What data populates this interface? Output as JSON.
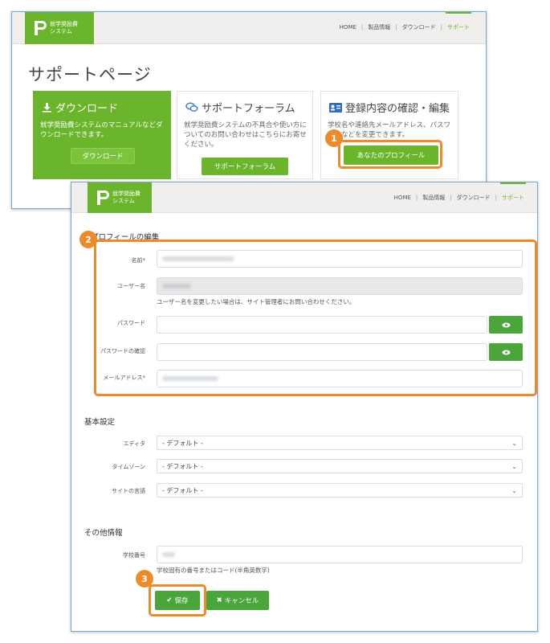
{
  "colors": {
    "brand": "#6ab52c",
    "callout": "#ec8a2c",
    "eye_button": "#4aa53a"
  },
  "logo": {
    "line1": "就学奨励費",
    "line2": "システム"
  },
  "nav": {
    "home": "HOME",
    "products": "製品情報",
    "download": "ダウンロード",
    "support": "サポート",
    "separator": "|"
  },
  "support_page": {
    "title": "サポートページ",
    "cards": [
      {
        "icon": "download-icon",
        "title": "ダウンロード",
        "desc": "就学奨励費システムのマニュアルなどダウンロードできます。",
        "button": "ダウンロード"
      },
      {
        "icon": "chat-bubbles-icon",
        "title": "サポートフォーラム",
        "desc": "就学奨励費システムの不具合や使い方についてのお問い合わせはこちらにお寄せください。",
        "button": "サポートフォーラム"
      },
      {
        "icon": "id-card-icon",
        "title": "登録内容の確認・編集",
        "desc": "学校名や連絡先メールアドレス、パスワードなどを変更できます。",
        "button": "あなたのプロフィール"
      }
    ]
  },
  "callouts": {
    "one": "1",
    "two": "2",
    "three": "3"
  },
  "profile_form": {
    "title": "プロフィールの編集",
    "fields": {
      "name_label": "名前",
      "required_mark": "*",
      "username_label": "ユーザー名",
      "username_help": "ユーザー名を変更したい場合は、サイト管理者にお問い合わせください。",
      "password_label": "パスワード",
      "password_confirm_label": "パスワードの確認",
      "email_label": "メールアドレス"
    },
    "basic_settings": {
      "title": "基本設定",
      "editor_label": "エディタ",
      "editor_value": "- デフォルト -",
      "timezone_label": "タイムゾーン",
      "timezone_value": "- デフォルト -",
      "language_label": "サイトの言語",
      "language_value": "- デフォルト -"
    },
    "other_info": {
      "title": "その他情報",
      "school_no_label": "学校番号",
      "school_no_help": "学校固有の番号またはコード(半角英数字)"
    },
    "save_button": "保存",
    "cancel_button": "キャンセル"
  }
}
